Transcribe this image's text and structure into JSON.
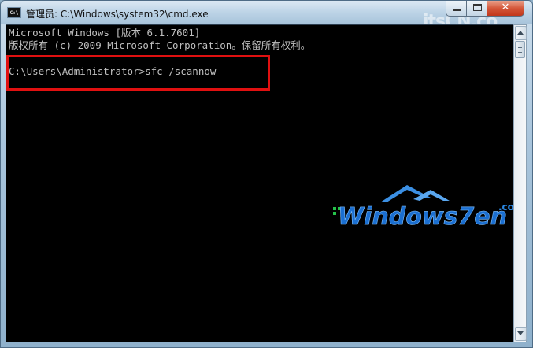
{
  "window": {
    "title": "管理员: C:\\Windows\\system32\\cmd.exe",
    "icon_text": "C:\\",
    "watermark": "itsCN.co"
  },
  "console": {
    "lines": [
      "Microsoft Windows [版本 6.1.7601]",
      "版权所有 (c) 2009 Microsoft Corporation。保留所有权利。",
      "C:\\Users\\Administrator>sfc /scannow"
    ],
    "text_color": "#c0c0c0",
    "background": "#000000"
  },
  "brand_watermark": {
    "main": "Windows7en",
    "suffix": ".com",
    "color": "#1b6fd1"
  },
  "icons": {
    "minimize": "minimize-icon",
    "maximize": "maximize-icon",
    "close": "close-icon",
    "scroll_up": "arrow-up-icon",
    "scroll_down": "arrow-down-icon"
  },
  "highlight_color": "#e01010",
  "close_glyph": "✕"
}
